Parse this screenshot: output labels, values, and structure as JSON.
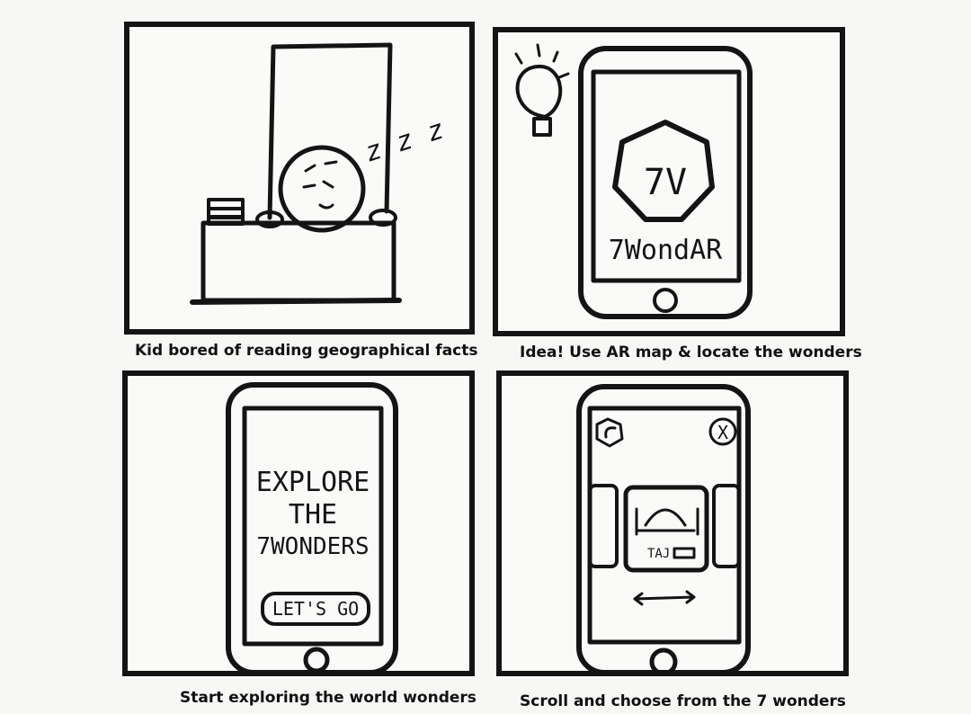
{
  "panels": [
    {
      "caption": "Kid bored of reading geographical facts",
      "sleep_text": "z z z"
    },
    {
      "caption": "Idea! Use AR map & locate the wonders",
      "app_logo_text": "7WondAR",
      "logo_mark": "7V"
    },
    {
      "caption": "Start exploring the world wonders",
      "screen_lines": [
        "EXPLORE",
        "THE",
        "7WONDERS"
      ],
      "button_label": "LET'S GO"
    },
    {
      "caption": "Scroll and choose from the 7 wonders",
      "card_label": "TAJ",
      "back_icon": "back-icon",
      "close_icon": "close-icon",
      "close_glyph": "X"
    }
  ]
}
